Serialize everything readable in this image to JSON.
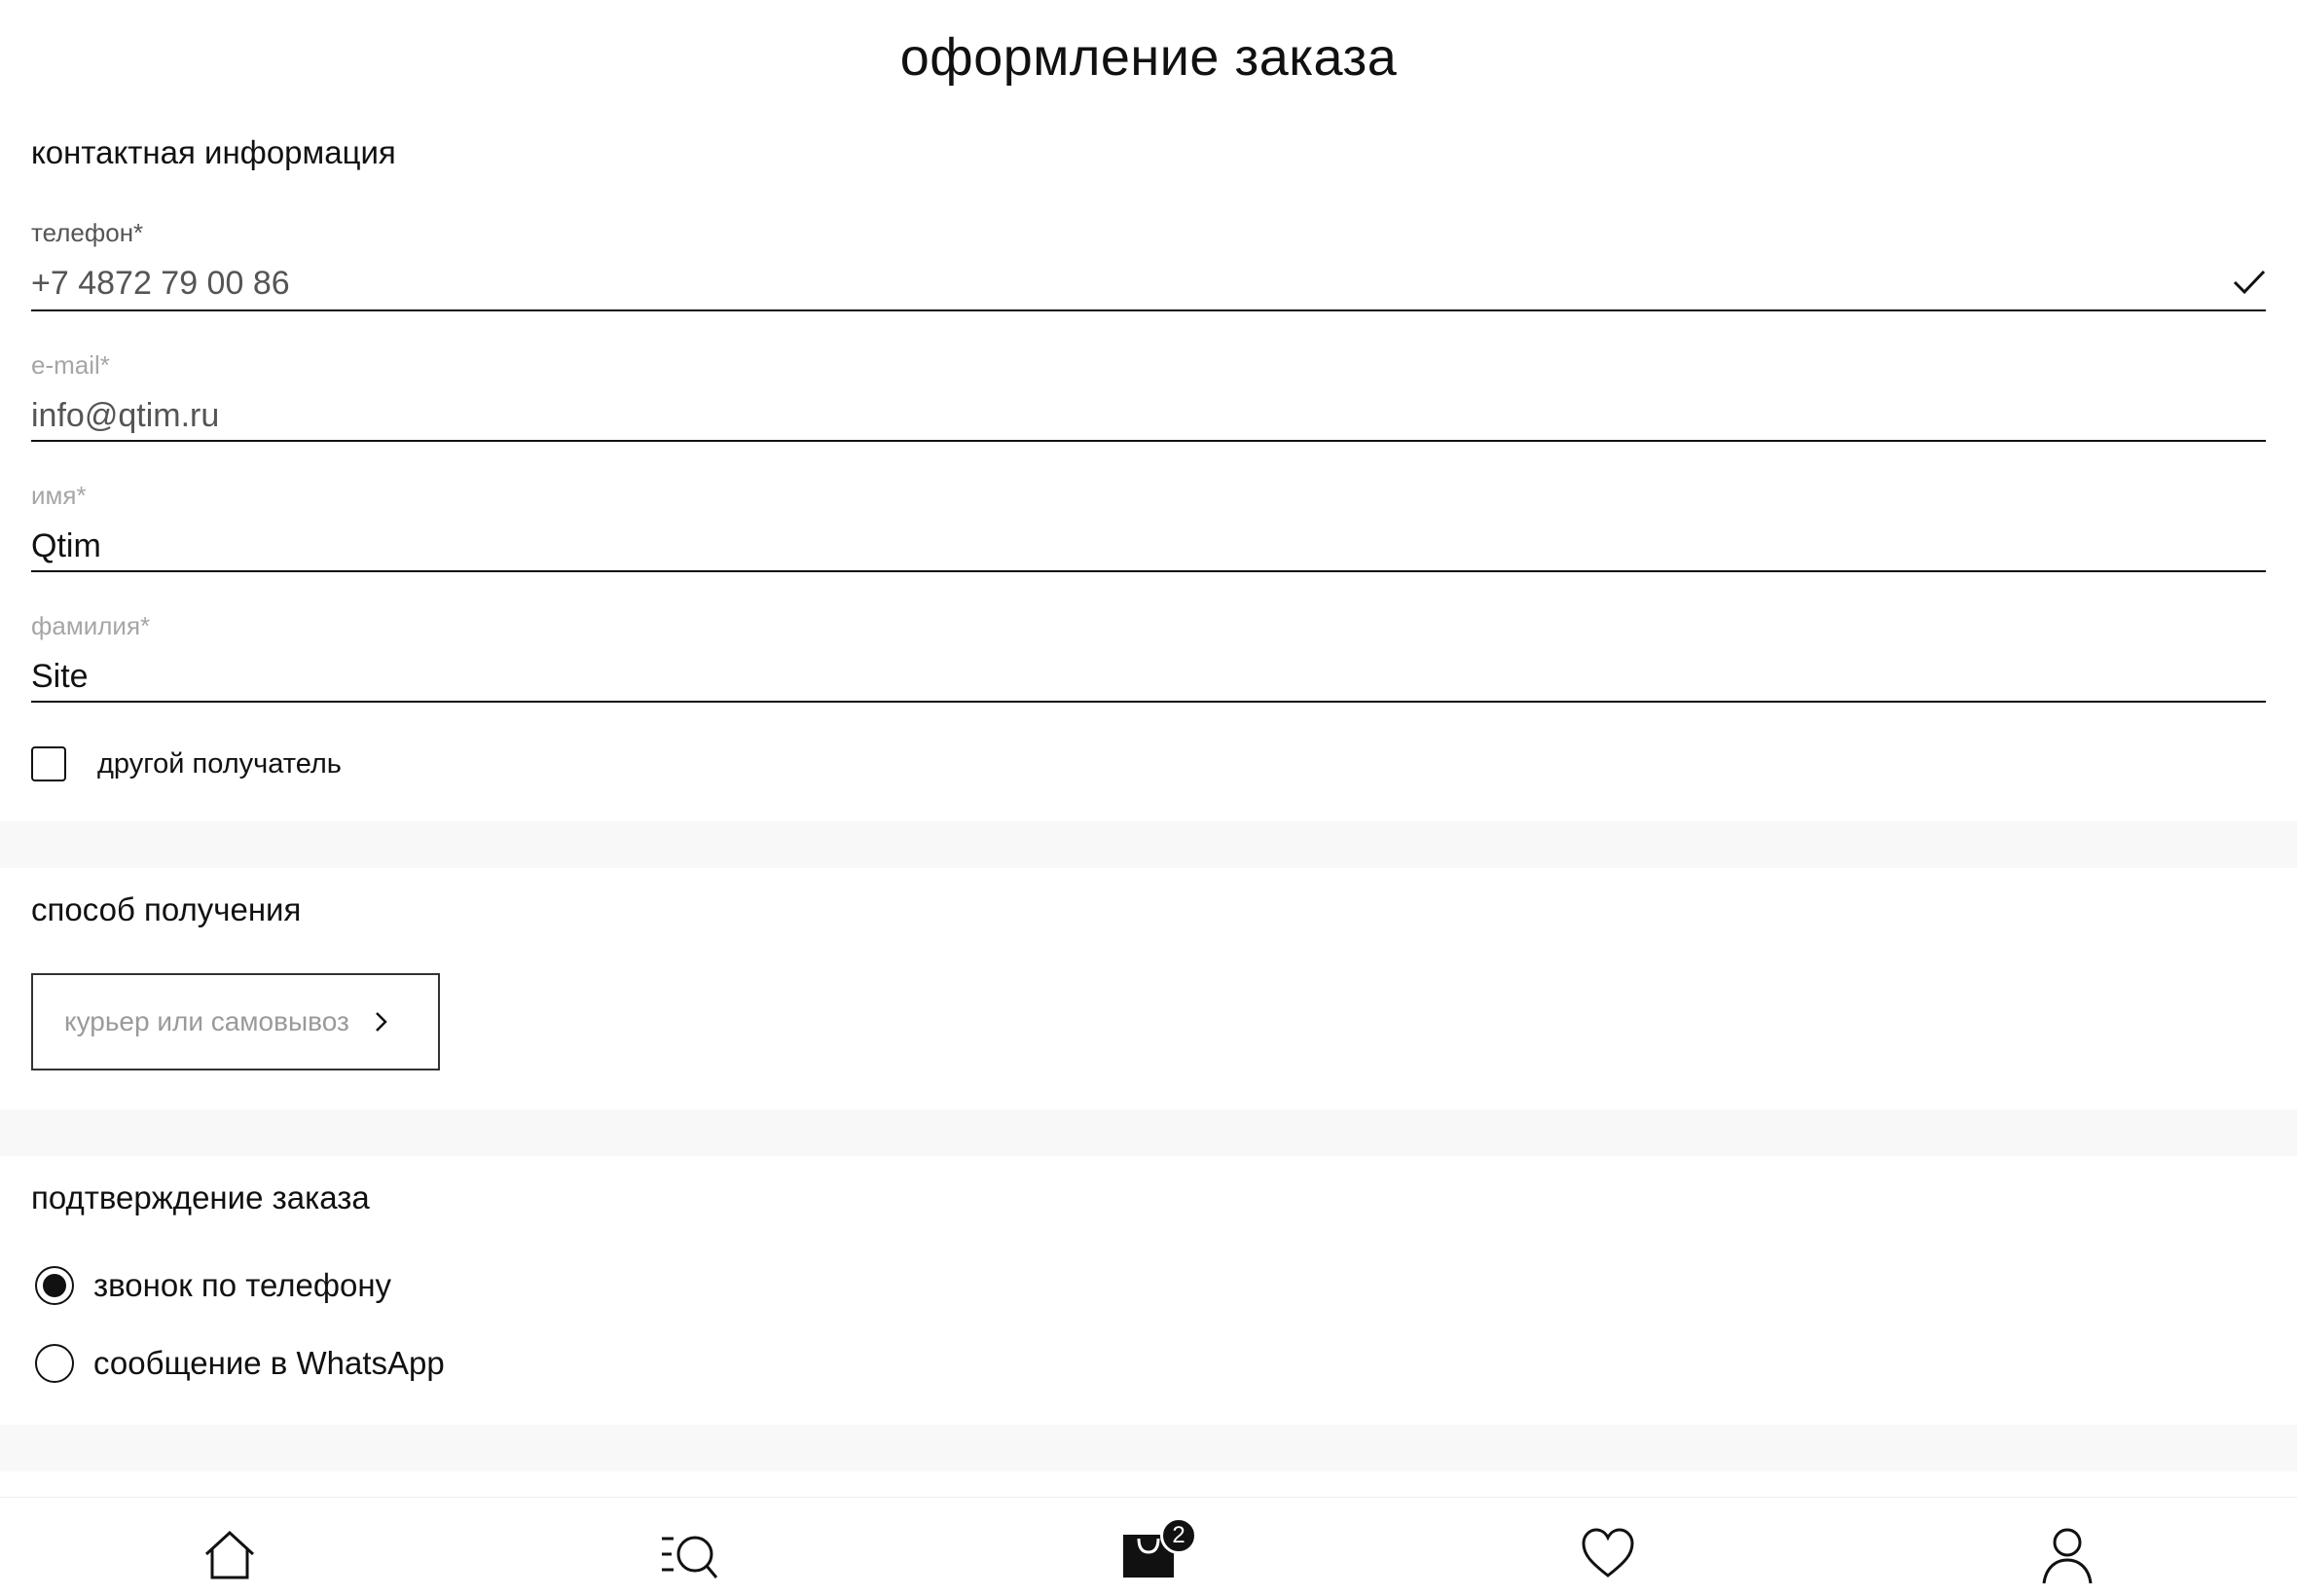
{
  "page": {
    "title": "оформление заказа"
  },
  "contact": {
    "section_title": "контактная информация",
    "fields": [
      {
        "label": "телефон*",
        "value": "+7 4872 79 00 86",
        "verified": true
      },
      {
        "label": "e-mail*",
        "value": "info@qtim.ru"
      },
      {
        "label": "имя*",
        "value": "Qtim"
      },
      {
        "label": "фамилия*",
        "value": "Site"
      }
    ],
    "other_recipient": {
      "label": "другой получатель",
      "checked": false
    }
  },
  "delivery": {
    "section_title": "способ получения",
    "button_label": "курьер или самовывоз"
  },
  "confirmation": {
    "section_title": "подтверждение заказа",
    "options": [
      {
        "label": "звонок по телефону",
        "selected": true
      },
      {
        "label": "сообщение в WhatsApp",
        "selected": false
      }
    ]
  },
  "tabbar": {
    "items": [
      {
        "name": "home",
        "icon": "home-icon"
      },
      {
        "name": "catalog-search",
        "icon": "catalog-search-icon"
      },
      {
        "name": "cart",
        "icon": "cart-bag-icon",
        "badge": "2"
      },
      {
        "name": "favorites",
        "icon": "heart-icon"
      },
      {
        "name": "profile",
        "icon": "user-icon"
      }
    ]
  },
  "colors": {
    "text": "#111111",
    "label_grey": "#a6a6a6",
    "divider_band": "#f8f8f8",
    "background": "#ffffff"
  }
}
